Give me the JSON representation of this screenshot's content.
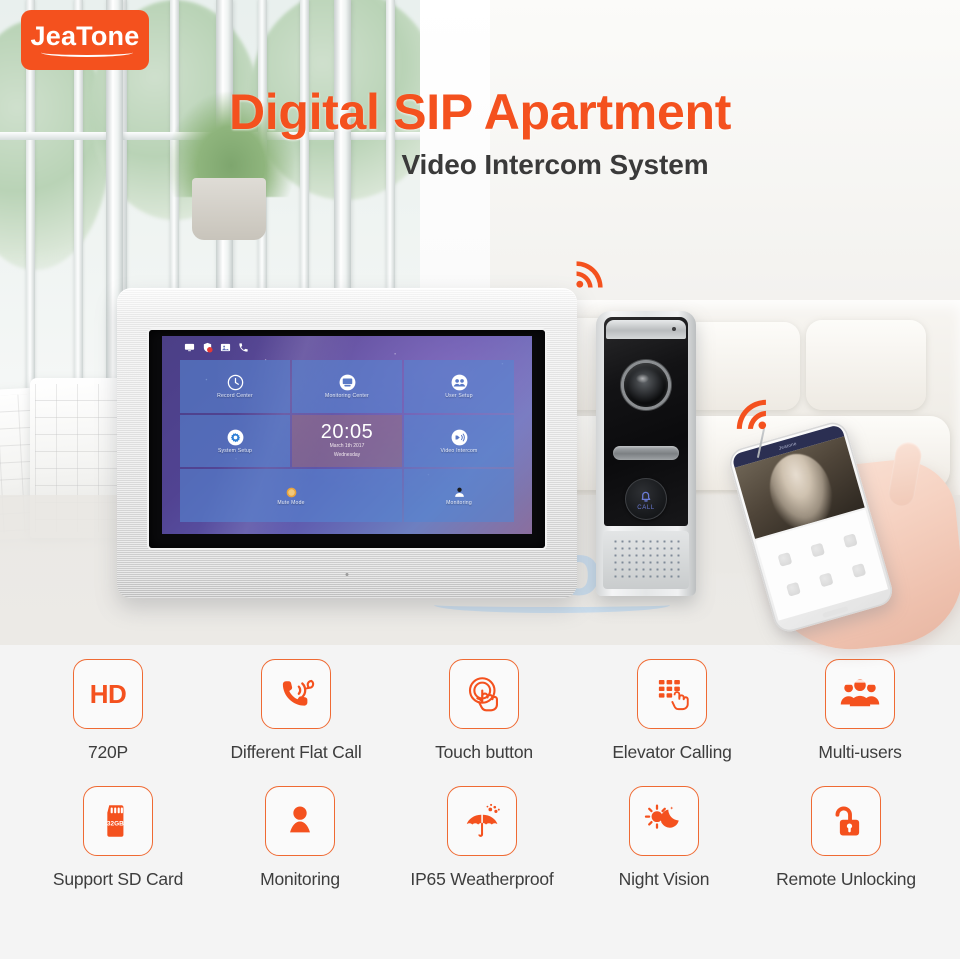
{
  "brand": {
    "name": "JeaTone",
    "accent": "#f4511e",
    "watermark_color": "#c5dbef"
  },
  "headline": {
    "title": "Digital SIP Apartment",
    "subtitle": "Video Intercom System"
  },
  "monitor": {
    "status_icons": [
      "monitor-icon",
      "shield-icon",
      "sd-card-icon",
      "phone-icon"
    ],
    "tiles": [
      {
        "label": "Record Center",
        "icon": "clock-icon"
      },
      {
        "label": "Monitoring Center",
        "icon": "monitor-screen-icon"
      },
      {
        "label": "User Setup",
        "icon": "users-icon"
      },
      {
        "label": "System Setup",
        "icon": "gear-icon"
      },
      {
        "label": "Video Intercom",
        "icon": "intercom-icon"
      },
      {
        "label": "Mute Mode",
        "icon": "mute-icon"
      },
      {
        "label": "Monitoring",
        "icon": "camera-person-icon"
      }
    ],
    "clock": {
      "time": "20:05",
      "date": "March 1th 2017",
      "weekday": "Wednesday"
    }
  },
  "door_station": {
    "call_label": "CALL",
    "call_icon": "bell-icon",
    "camera_icon": "camera-lens-icon"
  },
  "phone": {
    "app_title": "Jeatone",
    "video_subject": "baby-video-feed"
  },
  "signals": [
    {
      "name": "wifi-signal-icon-left"
    },
    {
      "name": "wifi-signal-icon-right"
    }
  ],
  "features": {
    "row1": [
      {
        "label": "720P",
        "icon": "hd-icon",
        "icon_text": "HD"
      },
      {
        "label": "Different Flat Call",
        "icon": "phone-call-icon"
      },
      {
        "label": "Touch button",
        "icon": "touch-button-icon"
      },
      {
        "label": "Elevator Calling",
        "icon": "elevator-keypad-icon"
      },
      {
        "label": "Multi-users",
        "icon": "multi-users-icon"
      }
    ],
    "row2": [
      {
        "label": "Support SD Card",
        "icon": "sd-card-icon",
        "icon_text": "32GB"
      },
      {
        "label": "Monitoring",
        "icon": "person-monitor-icon"
      },
      {
        "label": "IP65 Weatherproof",
        "icon": "umbrella-rain-icon"
      },
      {
        "label": "Night Vision",
        "icon": "sun-moon-icon"
      },
      {
        "label": "Remote Unlocking",
        "icon": "unlock-icon"
      }
    ]
  }
}
